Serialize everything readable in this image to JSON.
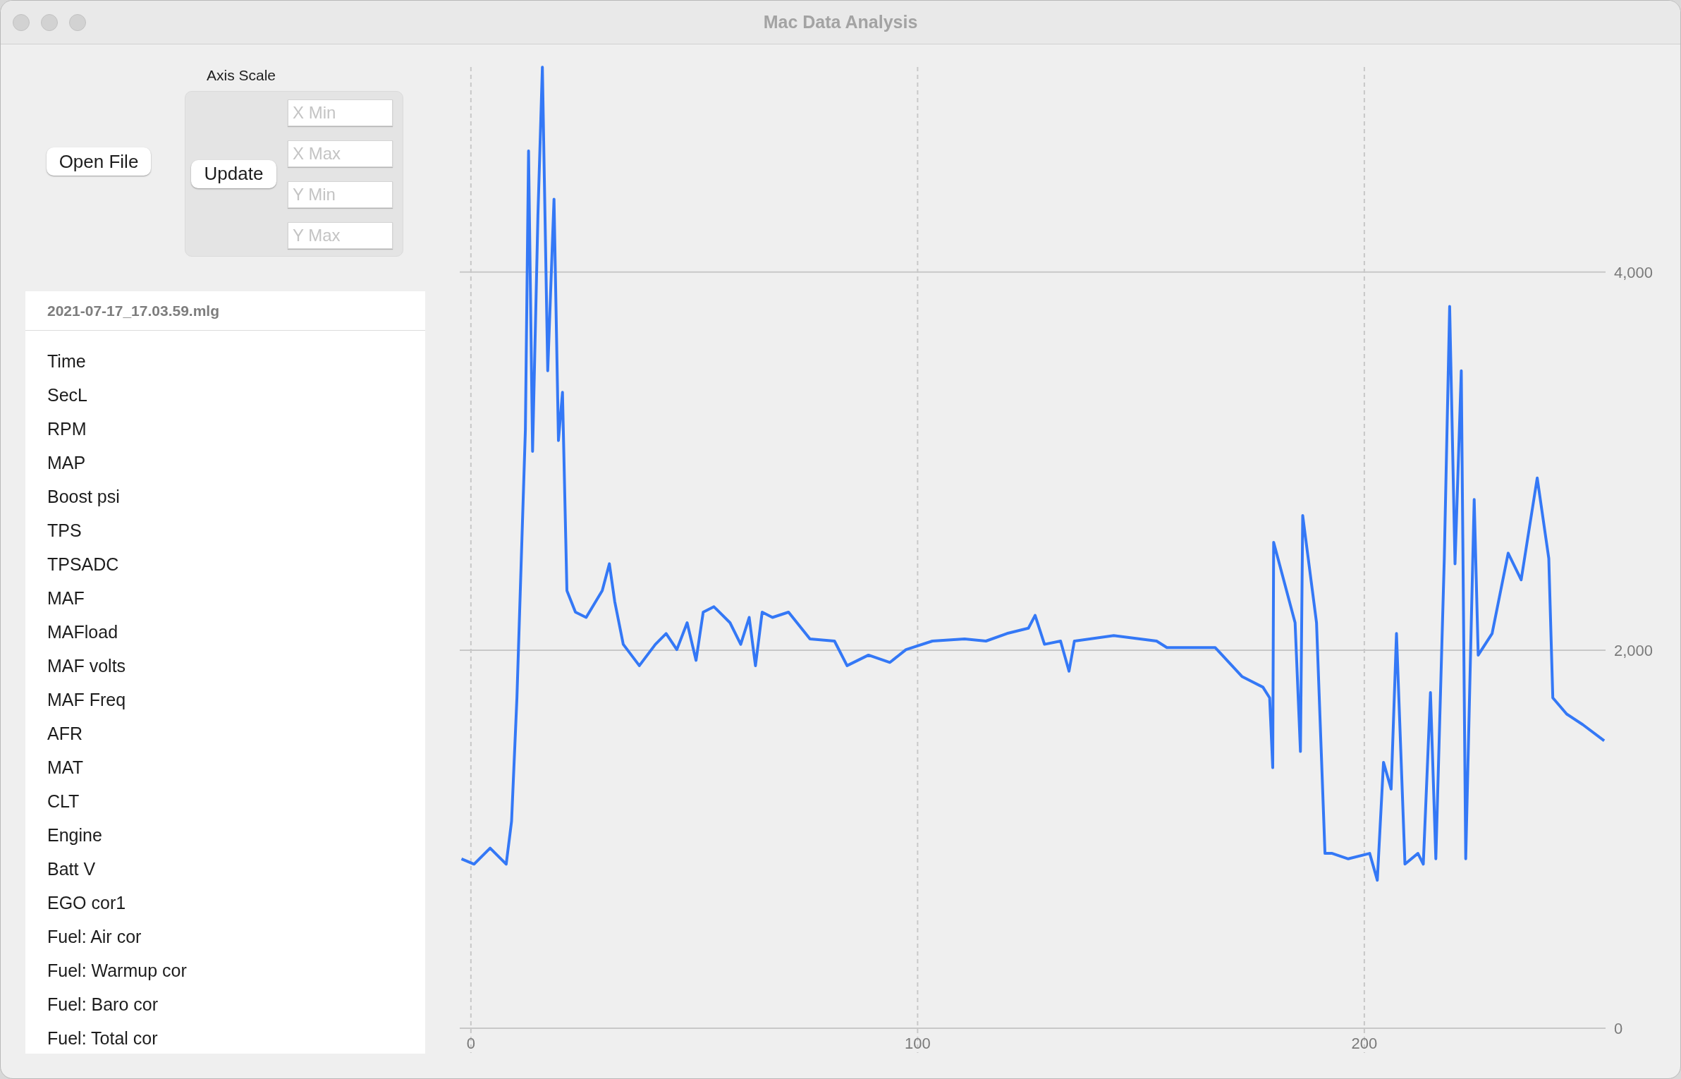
{
  "window": {
    "title": "Mac Data Analysis"
  },
  "toolbar": {
    "open_button": "Open File",
    "axis_scale": {
      "title": "Axis Scale",
      "update_button": "Update",
      "fields": [
        {
          "placeholder": "X Min"
        },
        {
          "placeholder": "X Max"
        },
        {
          "placeholder": "Y Min"
        },
        {
          "placeholder": "Y Max"
        }
      ]
    }
  },
  "channel_list": {
    "header": "2021-07-17_17.03.59.mlg",
    "items": [
      "Time",
      "SecL",
      "RPM",
      "MAP",
      "Boost psi",
      "TPS",
      "TPSADC",
      "MAF",
      "MAFload",
      "MAF volts",
      "MAF Freq",
      "AFR",
      "MAT",
      "CLT",
      "Engine",
      "Batt V",
      "EGO cor1",
      "Fuel: Air cor",
      "Fuel: Warmup cor",
      "Fuel: Baro cor",
      "Fuel: Total cor"
    ]
  },
  "chart": {
    "chart_data": {
      "type": "line",
      "grid": true,
      "xlim": [
        -2.5,
        254
      ],
      "ylim": [
        0,
        5085
      ],
      "xticks": [
        0,
        100,
        200
      ],
      "yticks": [
        {
          "value": 0,
          "label": "0"
        },
        {
          "value": 2000,
          "label": "2,000"
        },
        {
          "value": 4000,
          "label": "4,000"
        }
      ],
      "x": [
        -2.1,
        0.7,
        4.3,
        7.9,
        9.1,
        10.3,
        12.2,
        12.9,
        13.8,
        15,
        16,
        17.2,
        18.6,
        19.6,
        20.5,
        21.5,
        23.4,
        25.8,
        29.4,
        31,
        32.2,
        34.1,
        37.7,
        41.3,
        43.7,
        46.1,
        48.4,
        50.4,
        52,
        54.4,
        58,
        60.4,
        62.3,
        63.7,
        65.2,
        67.5,
        71.1,
        75.9,
        81.4,
        84.2,
        89,
        93.8,
        97.4,
        103.3,
        110.5,
        115.3,
        120,
        124.8,
        126.3,
        128.4,
        132,
        133.9,
        135.1,
        143.9,
        153.5,
        155.8,
        166.6,
        172.6,
        177.3,
        178.8,
        179.5,
        179.7,
        184.5,
        185.7,
        186.2,
        189.3,
        191.2,
        192.8,
        196.4,
        201.2,
        202.9,
        204.3,
        206,
        207.2,
        209.1,
        212,
        213.2,
        214.8,
        216,
        217.9,
        219.1,
        220.3,
        221.7,
        222.7,
        224.6,
        225.5,
        228.6,
        232.2,
        235.1,
        238.7,
        241.3,
        242.2,
        245.3,
        248.9,
        253.7
      ],
      "series": [
        {
          "color": "#3478f6",
          "values": [
            896,
            868,
            953,
            868,
            1095,
            1748,
            3166,
            4641,
            3052,
            4301,
            5084,
            3478,
            4386,
            3109,
            3364,
            2315,
            2201,
            2173,
            2315,
            2457,
            2258,
            2031,
            1918,
            2031,
            2088,
            2003,
            2145,
            1946,
            2201,
            2230,
            2145,
            2031,
            2173,
            1918,
            2201,
            2173,
            2201,
            2059,
            2048,
            1918,
            1974,
            1935,
            2003,
            2048,
            2059,
            2048,
            2088,
            2116,
            2184,
            2031,
            2048,
            1889,
            2048,
            2077,
            2048,
            2014,
            2014,
            1861,
            1804,
            1748,
            1379,
            2570,
            2145,
            1464,
            2712,
            2145,
            925,
            925,
            896,
            925,
            783,
            1407,
            1265,
            2088,
            868,
            925,
            868,
            1776,
            896,
            2485,
            3818,
            2457,
            3478,
            896,
            2797,
            1974,
            2088,
            2513,
            2372,
            2911,
            2485,
            1748,
            1662,
            1606,
            1521
          ]
        }
      ]
    }
  }
}
